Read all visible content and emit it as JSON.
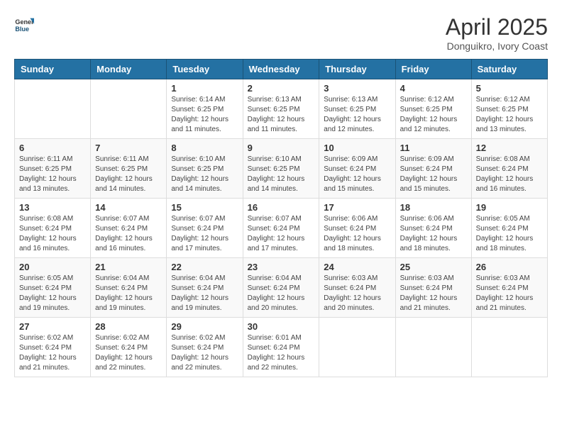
{
  "header": {
    "logo_general": "General",
    "logo_blue": "Blue",
    "title": "April 2025",
    "subtitle": "Donguikro, Ivory Coast"
  },
  "weekdays": [
    "Sunday",
    "Monday",
    "Tuesday",
    "Wednesday",
    "Thursday",
    "Friday",
    "Saturday"
  ],
  "weeks": [
    [
      {
        "day": "",
        "info": ""
      },
      {
        "day": "",
        "info": ""
      },
      {
        "day": "1",
        "info": "Sunrise: 6:14 AM\nSunset: 6:25 PM\nDaylight: 12 hours and 11 minutes."
      },
      {
        "day": "2",
        "info": "Sunrise: 6:13 AM\nSunset: 6:25 PM\nDaylight: 12 hours and 11 minutes."
      },
      {
        "day": "3",
        "info": "Sunrise: 6:13 AM\nSunset: 6:25 PM\nDaylight: 12 hours and 12 minutes."
      },
      {
        "day": "4",
        "info": "Sunrise: 6:12 AM\nSunset: 6:25 PM\nDaylight: 12 hours and 12 minutes."
      },
      {
        "day": "5",
        "info": "Sunrise: 6:12 AM\nSunset: 6:25 PM\nDaylight: 12 hours and 13 minutes."
      }
    ],
    [
      {
        "day": "6",
        "info": "Sunrise: 6:11 AM\nSunset: 6:25 PM\nDaylight: 12 hours and 13 minutes."
      },
      {
        "day": "7",
        "info": "Sunrise: 6:11 AM\nSunset: 6:25 PM\nDaylight: 12 hours and 14 minutes."
      },
      {
        "day": "8",
        "info": "Sunrise: 6:10 AM\nSunset: 6:25 PM\nDaylight: 12 hours and 14 minutes."
      },
      {
        "day": "9",
        "info": "Sunrise: 6:10 AM\nSunset: 6:25 PM\nDaylight: 12 hours and 14 minutes."
      },
      {
        "day": "10",
        "info": "Sunrise: 6:09 AM\nSunset: 6:24 PM\nDaylight: 12 hours and 15 minutes."
      },
      {
        "day": "11",
        "info": "Sunrise: 6:09 AM\nSunset: 6:24 PM\nDaylight: 12 hours and 15 minutes."
      },
      {
        "day": "12",
        "info": "Sunrise: 6:08 AM\nSunset: 6:24 PM\nDaylight: 12 hours and 16 minutes."
      }
    ],
    [
      {
        "day": "13",
        "info": "Sunrise: 6:08 AM\nSunset: 6:24 PM\nDaylight: 12 hours and 16 minutes."
      },
      {
        "day": "14",
        "info": "Sunrise: 6:07 AM\nSunset: 6:24 PM\nDaylight: 12 hours and 16 minutes."
      },
      {
        "day": "15",
        "info": "Sunrise: 6:07 AM\nSunset: 6:24 PM\nDaylight: 12 hours and 17 minutes."
      },
      {
        "day": "16",
        "info": "Sunrise: 6:07 AM\nSunset: 6:24 PM\nDaylight: 12 hours and 17 minutes."
      },
      {
        "day": "17",
        "info": "Sunrise: 6:06 AM\nSunset: 6:24 PM\nDaylight: 12 hours and 18 minutes."
      },
      {
        "day": "18",
        "info": "Sunrise: 6:06 AM\nSunset: 6:24 PM\nDaylight: 12 hours and 18 minutes."
      },
      {
        "day": "19",
        "info": "Sunrise: 6:05 AM\nSunset: 6:24 PM\nDaylight: 12 hours and 18 minutes."
      }
    ],
    [
      {
        "day": "20",
        "info": "Sunrise: 6:05 AM\nSunset: 6:24 PM\nDaylight: 12 hours and 19 minutes."
      },
      {
        "day": "21",
        "info": "Sunrise: 6:04 AM\nSunset: 6:24 PM\nDaylight: 12 hours and 19 minutes."
      },
      {
        "day": "22",
        "info": "Sunrise: 6:04 AM\nSunset: 6:24 PM\nDaylight: 12 hours and 19 minutes."
      },
      {
        "day": "23",
        "info": "Sunrise: 6:04 AM\nSunset: 6:24 PM\nDaylight: 12 hours and 20 minutes."
      },
      {
        "day": "24",
        "info": "Sunrise: 6:03 AM\nSunset: 6:24 PM\nDaylight: 12 hours and 20 minutes."
      },
      {
        "day": "25",
        "info": "Sunrise: 6:03 AM\nSunset: 6:24 PM\nDaylight: 12 hours and 21 minutes."
      },
      {
        "day": "26",
        "info": "Sunrise: 6:03 AM\nSunset: 6:24 PM\nDaylight: 12 hours and 21 minutes."
      }
    ],
    [
      {
        "day": "27",
        "info": "Sunrise: 6:02 AM\nSunset: 6:24 PM\nDaylight: 12 hours and 21 minutes."
      },
      {
        "day": "28",
        "info": "Sunrise: 6:02 AM\nSunset: 6:24 PM\nDaylight: 12 hours and 22 minutes."
      },
      {
        "day": "29",
        "info": "Sunrise: 6:02 AM\nSunset: 6:24 PM\nDaylight: 12 hours and 22 minutes."
      },
      {
        "day": "30",
        "info": "Sunrise: 6:01 AM\nSunset: 6:24 PM\nDaylight: 12 hours and 22 minutes."
      },
      {
        "day": "",
        "info": ""
      },
      {
        "day": "",
        "info": ""
      },
      {
        "day": "",
        "info": ""
      }
    ]
  ]
}
